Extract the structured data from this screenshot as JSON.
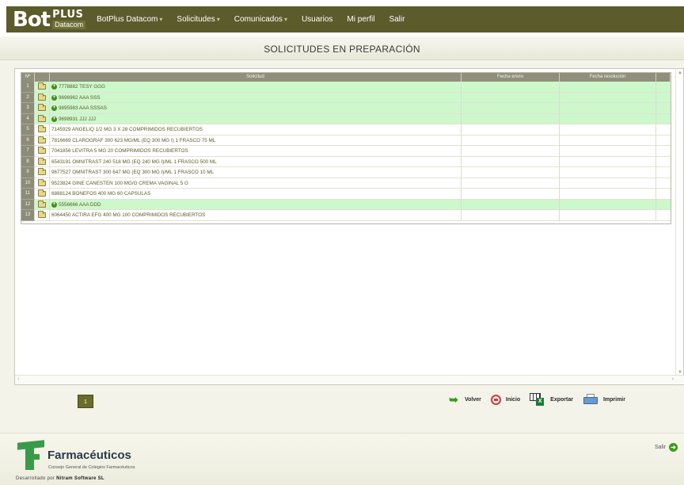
{
  "header": {
    "logo_main": "Bot",
    "logo_plus": "PLUS",
    "logo_sub": "Datacom",
    "menu": [
      {
        "label": "BotPlus Datacom",
        "has_caret": true
      },
      {
        "label": "Solicitudes",
        "has_caret": true
      },
      {
        "label": "Comunicados",
        "has_caret": true
      },
      {
        "label": "Usuarios",
        "has_caret": false
      },
      {
        "label": "Mi perfil",
        "has_caret": false
      },
      {
        "label": "Salir",
        "has_caret": false
      }
    ],
    "caret": "▾"
  },
  "page": {
    "title": "SOLICITUDES EN PREPARACIÓN"
  },
  "grid": {
    "columns": {
      "num": "Nº",
      "solicitud": "Solicitud",
      "fecha_envio": "Fecha envío",
      "fecha_resolucion": "Fecha resolución"
    },
    "rows": [
      {
        "num": "1",
        "text": "7778882 TESY GGG",
        "highlight": true,
        "new": true
      },
      {
        "num": "2",
        "text": "9696962 AAA SSS",
        "highlight": true,
        "new": true
      },
      {
        "num": "3",
        "text": "9895983 AAA SSSAS",
        "highlight": true,
        "new": true
      },
      {
        "num": "4",
        "text": "9698931 JJJ JJJ",
        "highlight": true,
        "new": true
      },
      {
        "num": "5",
        "text": "7145929 ANGELIQ 1/2 MG 3 X 28 COMPRIMIDOS RECUBIERTOS",
        "highlight": false,
        "new": false
      },
      {
        "num": "6",
        "text": "7816669 CLAROGRAF 300 623 MG/ML (EQ 300 MG I) 1 FRASCO 75 ML",
        "highlight": false,
        "new": false
      },
      {
        "num": "7",
        "text": "7041856 LEVITRA 5 MG 20 COMPRIMIDOS RECUBIERTOS",
        "highlight": false,
        "new": false
      },
      {
        "num": "8",
        "text": "6543191 OMNITRAST 240 518 MG (EQ 240 MG I)/ML 1 FRASCO 500 ML",
        "highlight": false,
        "new": false
      },
      {
        "num": "9",
        "text": "9677527 OMNITRAST 300 647 MG (EQ 300 MG I)/ML 1 FRASCO 10 ML",
        "highlight": false,
        "new": false
      },
      {
        "num": "10",
        "text": "9523824 GINE CANESTEN 100 MG/G CREMA VAGINAL 5 G",
        "highlight": false,
        "new": false
      },
      {
        "num": "11",
        "text": "6888124 BONEFOS 400 MG 60 CAPSULAS",
        "highlight": false,
        "new": false
      },
      {
        "num": "12",
        "text": "5556666 AAA DDD",
        "highlight": true,
        "new": true
      },
      {
        "num": "13",
        "text": "6064450 ACTIRA EFG 400 MG 100 COMPRIMIDOS RECUBIERTOS",
        "highlight": false,
        "new": false
      }
    ]
  },
  "pagination": {
    "current": "1"
  },
  "actions": {
    "volver": "Volver",
    "inicio": "Inicio",
    "exportar": "Exportar",
    "imprimir": "Imprimir"
  },
  "footer": {
    "org_name": "Farmacéuticos",
    "org_tagline": "Consejo General de Colegios Farmacéuticos",
    "dev_prefix": "Desarrollado por",
    "dev_name": "Nitram Software SL",
    "logout": "Salir"
  },
  "colors": {
    "navbar": "#5b5b2b",
    "highlight_row": "#ccf8cc",
    "accent_green": "#3c9a1a"
  }
}
